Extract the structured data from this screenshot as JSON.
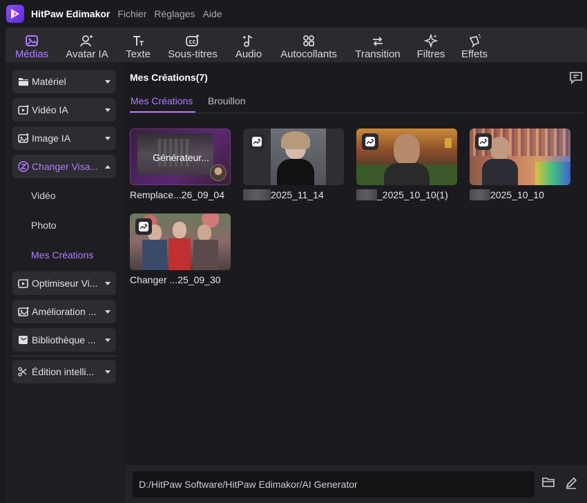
{
  "app": {
    "name": "HitPaw Edimakor",
    "menu": [
      "Fichier",
      "Réglages",
      "Aide"
    ]
  },
  "toolbar": {
    "items": [
      {
        "label": "Médias",
        "icon": "media-icon",
        "active": true
      },
      {
        "label": "Avatar IA",
        "icon": "avatar-icon"
      },
      {
        "label": "Texte",
        "icon": "text-icon"
      },
      {
        "label": "Sous-titres",
        "icon": "subtitles-icon"
      },
      {
        "label": "Audio",
        "icon": "audio-icon"
      },
      {
        "label": "Autocollants",
        "icon": "stickers-icon"
      },
      {
        "label": "Transition",
        "icon": "transition-icon"
      },
      {
        "label": "Filtres",
        "icon": "filters-icon"
      },
      {
        "label": "Effets",
        "icon": "effects-icon"
      }
    ]
  },
  "sidebar": {
    "items": [
      {
        "label": "Matériel",
        "icon": "folder-icon"
      },
      {
        "label": "Vidéo IA",
        "icon": "video-ai-icon"
      },
      {
        "label": "Image IA",
        "icon": "image-ai-icon"
      },
      {
        "label": "Changer Visa...",
        "icon": "face-swap-icon",
        "open": true
      },
      {
        "label": "Optimiseur Vi...",
        "icon": "video-optimizer-icon"
      },
      {
        "label": "Amélioration ...",
        "icon": "enhance-icon"
      },
      {
        "label": "Bibliothèque ...",
        "icon": "library-icon"
      },
      {
        "label": "Édition intelli...",
        "icon": "smart-edit-icon"
      }
    ],
    "subitems": [
      "Vidéo",
      "Photo",
      "Mes Créations"
    ]
  },
  "main": {
    "title": "Mes Créations(7)",
    "tabs": [
      "Mes Créations",
      "Brouillon"
    ],
    "cards": [
      {
        "overlay": "Générateur...",
        "caption": "Remplace...26_09_04"
      },
      {
        "caption": "2025_11_14"
      },
      {
        "caption": "_2025_10_10(1)"
      },
      {
        "caption": "2025_10_10"
      },
      {
        "caption": "Changer ...25_09_30"
      }
    ]
  },
  "footer": {
    "path": "D:/HitPaw Software/HitPaw Edimakor/AI Generator"
  },
  "colors": {
    "accent": "#b07cff",
    "background": "#1b1b1f",
    "panel": "#2a2a2f"
  }
}
